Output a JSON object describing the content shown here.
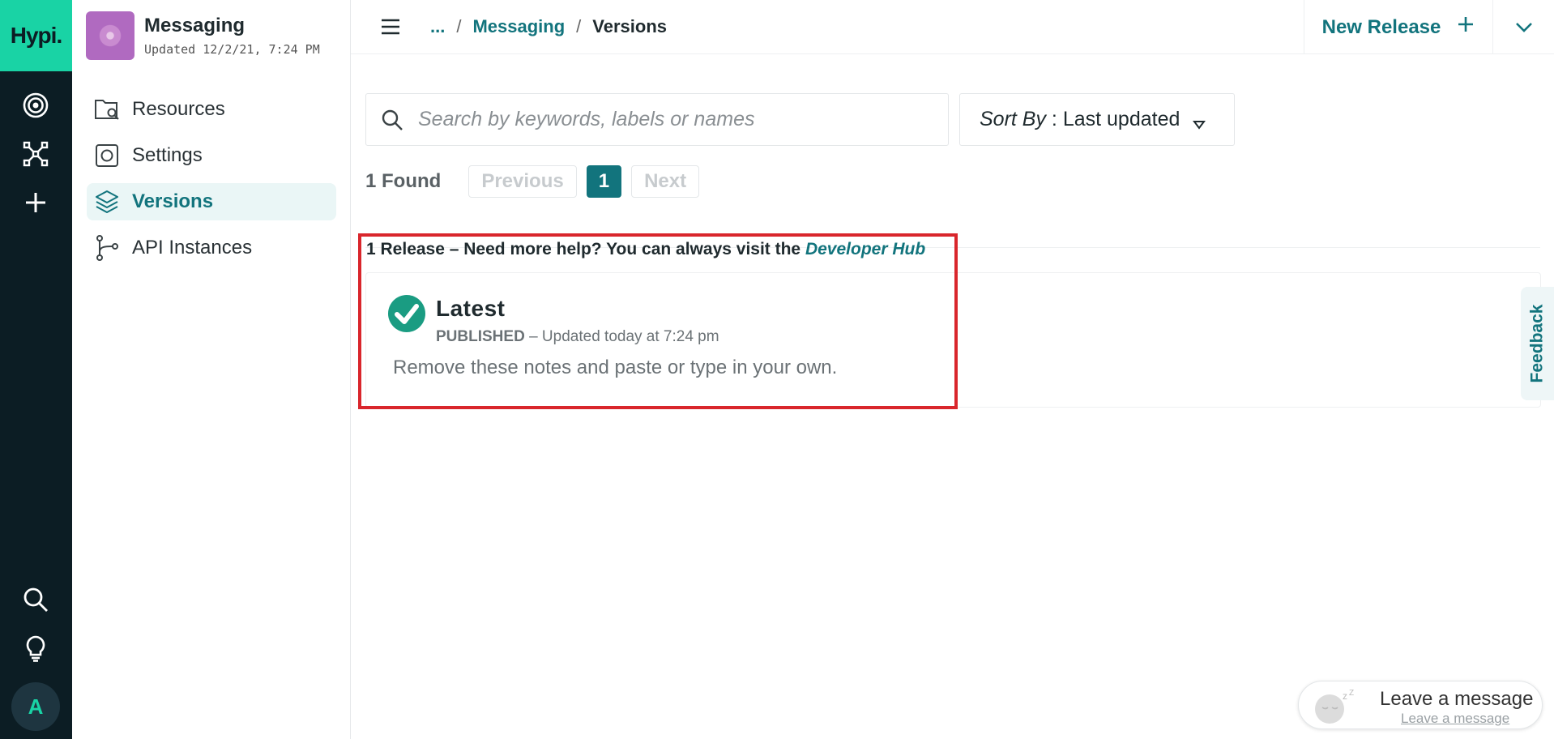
{
  "rail": {
    "logo": "Hypi.",
    "avatar_letter": "A"
  },
  "sidebar": {
    "app_name": "Messaging",
    "app_updated": "Updated 12/2/21, 7:24 PM",
    "items": [
      {
        "label": "Resources",
        "icon": "folder-search-icon"
      },
      {
        "label": "Settings",
        "icon": "settings-icon"
      },
      {
        "label": "Versions",
        "icon": "layers-icon",
        "active": true
      },
      {
        "label": "API Instances",
        "icon": "git-branch-icon"
      }
    ]
  },
  "header": {
    "breadcrumb": [
      "...",
      "Messaging",
      "Versions"
    ],
    "separator": "/",
    "new_release_label": "New Release"
  },
  "search": {
    "placeholder": "Search by keywords, labels or names"
  },
  "sort": {
    "label": "Sort By",
    "separator": " : ",
    "value": "Last updated"
  },
  "pagination": {
    "found": "1 Found",
    "previous": "Previous",
    "current": "1",
    "next": "Next"
  },
  "releases": {
    "summary_prefix": "1 Release – Need more help? You can always visit the ",
    "hub_link": "Developer Hub",
    "items": [
      {
        "name": "Latest",
        "status": "PUBLISHED",
        "updated": " – Updated today at 7:24 pm",
        "notes": "Remove these notes and paste or type in your own."
      }
    ]
  },
  "feedback_label": "Feedback",
  "chat": {
    "title": "Leave a message",
    "link": "Leave a message"
  },
  "colors": {
    "accent": "#12747d",
    "brand": "#19d3a5",
    "rail": "#0c1d24",
    "highlight": "#d9262c"
  }
}
